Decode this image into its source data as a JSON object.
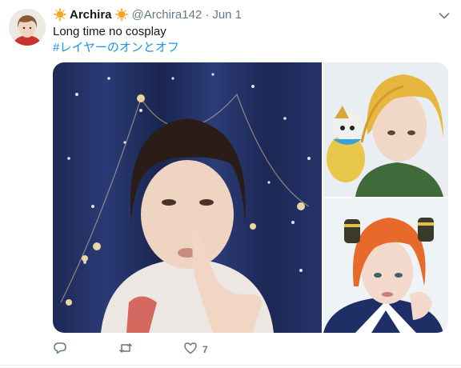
{
  "tweet": {
    "display_name": "Archira",
    "handle": "@Archira142",
    "separator": "·",
    "date": "Jun 1",
    "text": "Long time no cosplay",
    "hashtag": "#レイヤーのオンとオフ",
    "like_count": "7"
  },
  "icons": {
    "decor_left": "sun-emoji-icon",
    "decor_right": "sun-emoji-icon",
    "menu": "chevron-down-icon",
    "reply": "reply-icon",
    "retweet": "retweet-icon",
    "like": "heart-icon"
  },
  "colors": {
    "text": "#14171a",
    "secondary": "#657786",
    "link": "#1b95e0",
    "emoji": "#f5a623"
  }
}
